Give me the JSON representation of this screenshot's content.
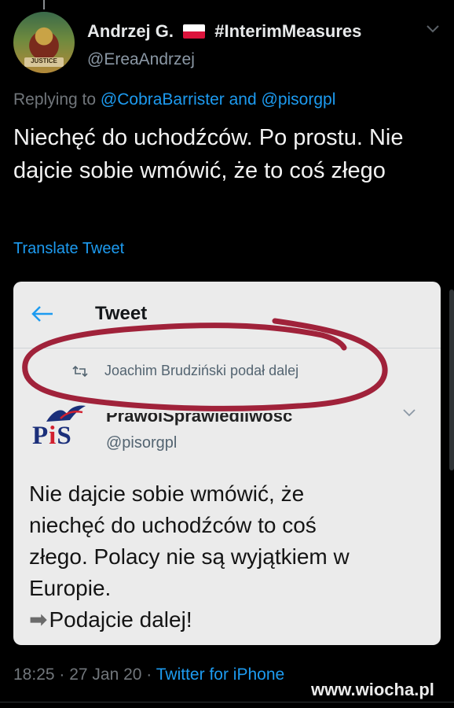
{
  "tweet": {
    "author": {
      "display_name": "Andrzej G.",
      "hashtag": "#InterimMeasures",
      "handle": "@EreaAndrzej",
      "avatar_ribbon_text": "JUSTICE",
      "flag": "poland-flag"
    },
    "replying_prefix": "Replying to",
    "replying_to_1": "@CobraBarrister",
    "replying_and": "and",
    "replying_to_2": "@pisorgpl",
    "text": "Niechęć do uchodźców. Po prostu. Nie dajcie sobie wmówić, że to coś złego",
    "translate_label": "Translate Tweet",
    "timestamp": "18:25 · 27 Jan 20 ·",
    "source": "Twitter for iPhone"
  },
  "embedded_screenshot": {
    "title": "Tweet",
    "retweet_text": "Joachim Brudziński podał dalej",
    "author_name": "PrawoiSprawiedliwość",
    "author_handle": "@pisorgpl",
    "logo_text": "PiS",
    "text_lines": [
      "Nie dajcie sobie wmówić, że",
      "niechęć do uchodźców to coś",
      "złego. Polacy nie są wyjątkiem w",
      "Europie."
    ],
    "call_to_action": "Podajcie dalej!"
  },
  "watermark": "www.wiocha.pl",
  "colors": {
    "background": "#000000",
    "link": "#1d9bf0",
    "annotation_circle": "#a0223a",
    "card_background": "#ebebeb"
  }
}
